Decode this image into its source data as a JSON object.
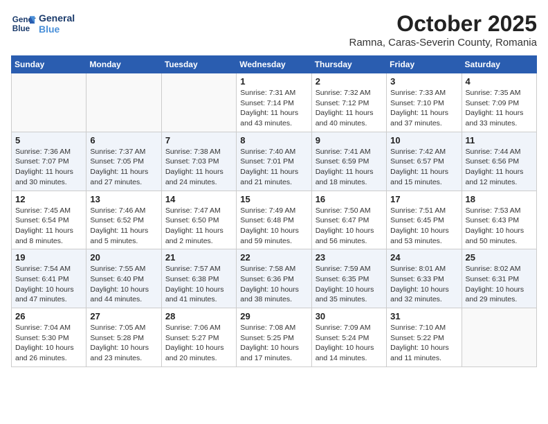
{
  "header": {
    "logo_line1": "General",
    "logo_line2": "Blue",
    "month": "October 2025",
    "location": "Ramna, Caras-Severin County, Romania"
  },
  "weekdays": [
    "Sunday",
    "Monday",
    "Tuesday",
    "Wednesday",
    "Thursday",
    "Friday",
    "Saturday"
  ],
  "weeks": [
    [
      {
        "day": "",
        "info": ""
      },
      {
        "day": "",
        "info": ""
      },
      {
        "day": "",
        "info": ""
      },
      {
        "day": "1",
        "info": "Sunrise: 7:31 AM\nSunset: 7:14 PM\nDaylight: 11 hours\nand 43 minutes."
      },
      {
        "day": "2",
        "info": "Sunrise: 7:32 AM\nSunset: 7:12 PM\nDaylight: 11 hours\nand 40 minutes."
      },
      {
        "day": "3",
        "info": "Sunrise: 7:33 AM\nSunset: 7:10 PM\nDaylight: 11 hours\nand 37 minutes."
      },
      {
        "day": "4",
        "info": "Sunrise: 7:35 AM\nSunset: 7:09 PM\nDaylight: 11 hours\nand 33 minutes."
      }
    ],
    [
      {
        "day": "5",
        "info": "Sunrise: 7:36 AM\nSunset: 7:07 PM\nDaylight: 11 hours\nand 30 minutes."
      },
      {
        "day": "6",
        "info": "Sunrise: 7:37 AM\nSunset: 7:05 PM\nDaylight: 11 hours\nand 27 minutes."
      },
      {
        "day": "7",
        "info": "Sunrise: 7:38 AM\nSunset: 7:03 PM\nDaylight: 11 hours\nand 24 minutes."
      },
      {
        "day": "8",
        "info": "Sunrise: 7:40 AM\nSunset: 7:01 PM\nDaylight: 11 hours\nand 21 minutes."
      },
      {
        "day": "9",
        "info": "Sunrise: 7:41 AM\nSunset: 6:59 PM\nDaylight: 11 hours\nand 18 minutes."
      },
      {
        "day": "10",
        "info": "Sunrise: 7:42 AM\nSunset: 6:57 PM\nDaylight: 11 hours\nand 15 minutes."
      },
      {
        "day": "11",
        "info": "Sunrise: 7:44 AM\nSunset: 6:56 PM\nDaylight: 11 hours\nand 12 minutes."
      }
    ],
    [
      {
        "day": "12",
        "info": "Sunrise: 7:45 AM\nSunset: 6:54 PM\nDaylight: 11 hours\nand 8 minutes."
      },
      {
        "day": "13",
        "info": "Sunrise: 7:46 AM\nSunset: 6:52 PM\nDaylight: 11 hours\nand 5 minutes."
      },
      {
        "day": "14",
        "info": "Sunrise: 7:47 AM\nSunset: 6:50 PM\nDaylight: 11 hours\nand 2 minutes."
      },
      {
        "day": "15",
        "info": "Sunrise: 7:49 AM\nSunset: 6:48 PM\nDaylight: 10 hours\nand 59 minutes."
      },
      {
        "day": "16",
        "info": "Sunrise: 7:50 AM\nSunset: 6:47 PM\nDaylight: 10 hours\nand 56 minutes."
      },
      {
        "day": "17",
        "info": "Sunrise: 7:51 AM\nSunset: 6:45 PM\nDaylight: 10 hours\nand 53 minutes."
      },
      {
        "day": "18",
        "info": "Sunrise: 7:53 AM\nSunset: 6:43 PM\nDaylight: 10 hours\nand 50 minutes."
      }
    ],
    [
      {
        "day": "19",
        "info": "Sunrise: 7:54 AM\nSunset: 6:41 PM\nDaylight: 10 hours\nand 47 minutes."
      },
      {
        "day": "20",
        "info": "Sunrise: 7:55 AM\nSunset: 6:40 PM\nDaylight: 10 hours\nand 44 minutes."
      },
      {
        "day": "21",
        "info": "Sunrise: 7:57 AM\nSunset: 6:38 PM\nDaylight: 10 hours\nand 41 minutes."
      },
      {
        "day": "22",
        "info": "Sunrise: 7:58 AM\nSunset: 6:36 PM\nDaylight: 10 hours\nand 38 minutes."
      },
      {
        "day": "23",
        "info": "Sunrise: 7:59 AM\nSunset: 6:35 PM\nDaylight: 10 hours\nand 35 minutes."
      },
      {
        "day": "24",
        "info": "Sunrise: 8:01 AM\nSunset: 6:33 PM\nDaylight: 10 hours\nand 32 minutes."
      },
      {
        "day": "25",
        "info": "Sunrise: 8:02 AM\nSunset: 6:31 PM\nDaylight: 10 hours\nand 29 minutes."
      }
    ],
    [
      {
        "day": "26",
        "info": "Sunrise: 7:04 AM\nSunset: 5:30 PM\nDaylight: 10 hours\nand 26 minutes."
      },
      {
        "day": "27",
        "info": "Sunrise: 7:05 AM\nSunset: 5:28 PM\nDaylight: 10 hours\nand 23 minutes."
      },
      {
        "day": "28",
        "info": "Sunrise: 7:06 AM\nSunset: 5:27 PM\nDaylight: 10 hours\nand 20 minutes."
      },
      {
        "day": "29",
        "info": "Sunrise: 7:08 AM\nSunset: 5:25 PM\nDaylight: 10 hours\nand 17 minutes."
      },
      {
        "day": "30",
        "info": "Sunrise: 7:09 AM\nSunset: 5:24 PM\nDaylight: 10 hours\nand 14 minutes."
      },
      {
        "day": "31",
        "info": "Sunrise: 7:10 AM\nSunset: 5:22 PM\nDaylight: 10 hours\nand 11 minutes."
      },
      {
        "day": "",
        "info": ""
      }
    ]
  ]
}
